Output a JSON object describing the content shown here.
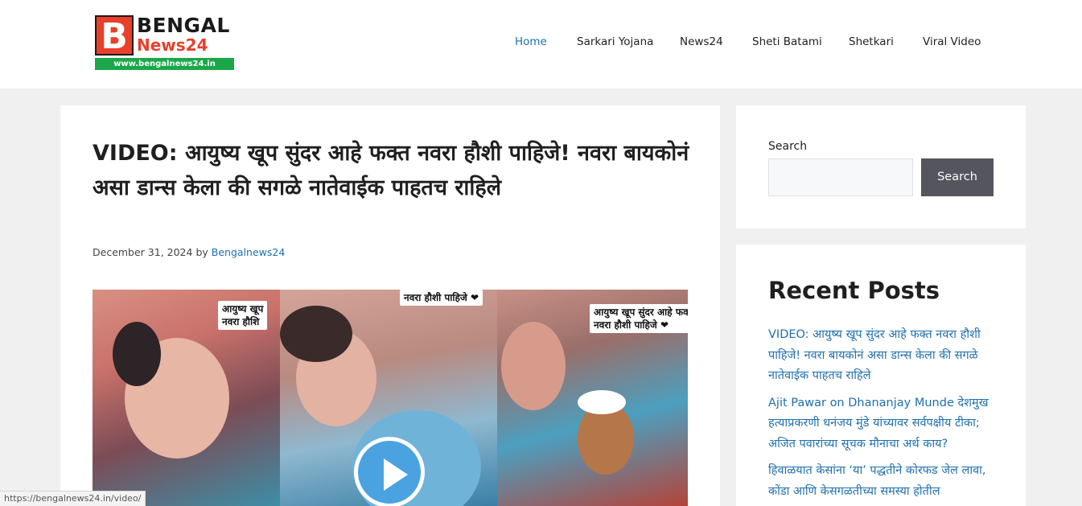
{
  "header": {
    "logo": {
      "letter": "B",
      "top_text": "BENGAL",
      "mid_text": "News24",
      "url_text": "www.bengalnews24.in"
    },
    "nav": [
      {
        "label": "Home",
        "active": true
      },
      {
        "label": "Sarkari Yojana",
        "active": false
      },
      {
        "label": "News24",
        "active": false
      },
      {
        "label": "Sheti Batami",
        "active": false
      },
      {
        "label": "Shetkari",
        "active": false
      },
      {
        "label": "Viral Video",
        "active": false
      }
    ]
  },
  "article": {
    "title": "VIDEO: आयुष्य खूप सुंदर आहे फक्त नवरा हौशी पाहिजे! नवरा बायकोनं असा डान्स केला की सगळे नातेवाईक पाहतच राहिले",
    "date": "December 31, 2024",
    "by": "by",
    "author": "Bengalnews24",
    "video": {
      "captions": [
        "आयुष्य खूप\nनवरा हौशि",
        "नवरा हौशी पाहिजे ❤",
        "आयुष्य खूप सुंदर आहे फक्त\nनवरा हौशी पाहिजे ❤"
      ]
    }
  },
  "sidebar": {
    "search": {
      "label": "Search",
      "placeholder": "",
      "button": "Search"
    },
    "recent": {
      "title": "Recent Posts",
      "items": [
        "VIDEO: आयुष्य खूप सुंदर आहे फक्त नवरा हौशी पाहिजे! नवरा बायकोनं असा डान्स केला की सगळे नातेवाईक पाहतच राहिले",
        "Ajit Pawar on Dhananjay Munde देशमुख हत्याप्रकरणी धनंजय मुंडे यांच्यावर सर्वपक्षीय टीका; अजित पवारांच्या सूचक मौनाचा अर्थ काय?",
        "हिवाळयात केसांना ‘या’ पद्धतीने कोरफड जेल लावा, कोंडा आणि केसगळतीच्या समस्या होतील"
      ]
    }
  },
  "status_bar": {
    "url": "https://bengalnews24.in/video/"
  },
  "colors": {
    "link": "#1e6fae",
    "logo_red": "#e8402b",
    "logo_green": "#1aa84a",
    "search_button": "#55555e",
    "play_button": "#4aa3e0"
  }
}
